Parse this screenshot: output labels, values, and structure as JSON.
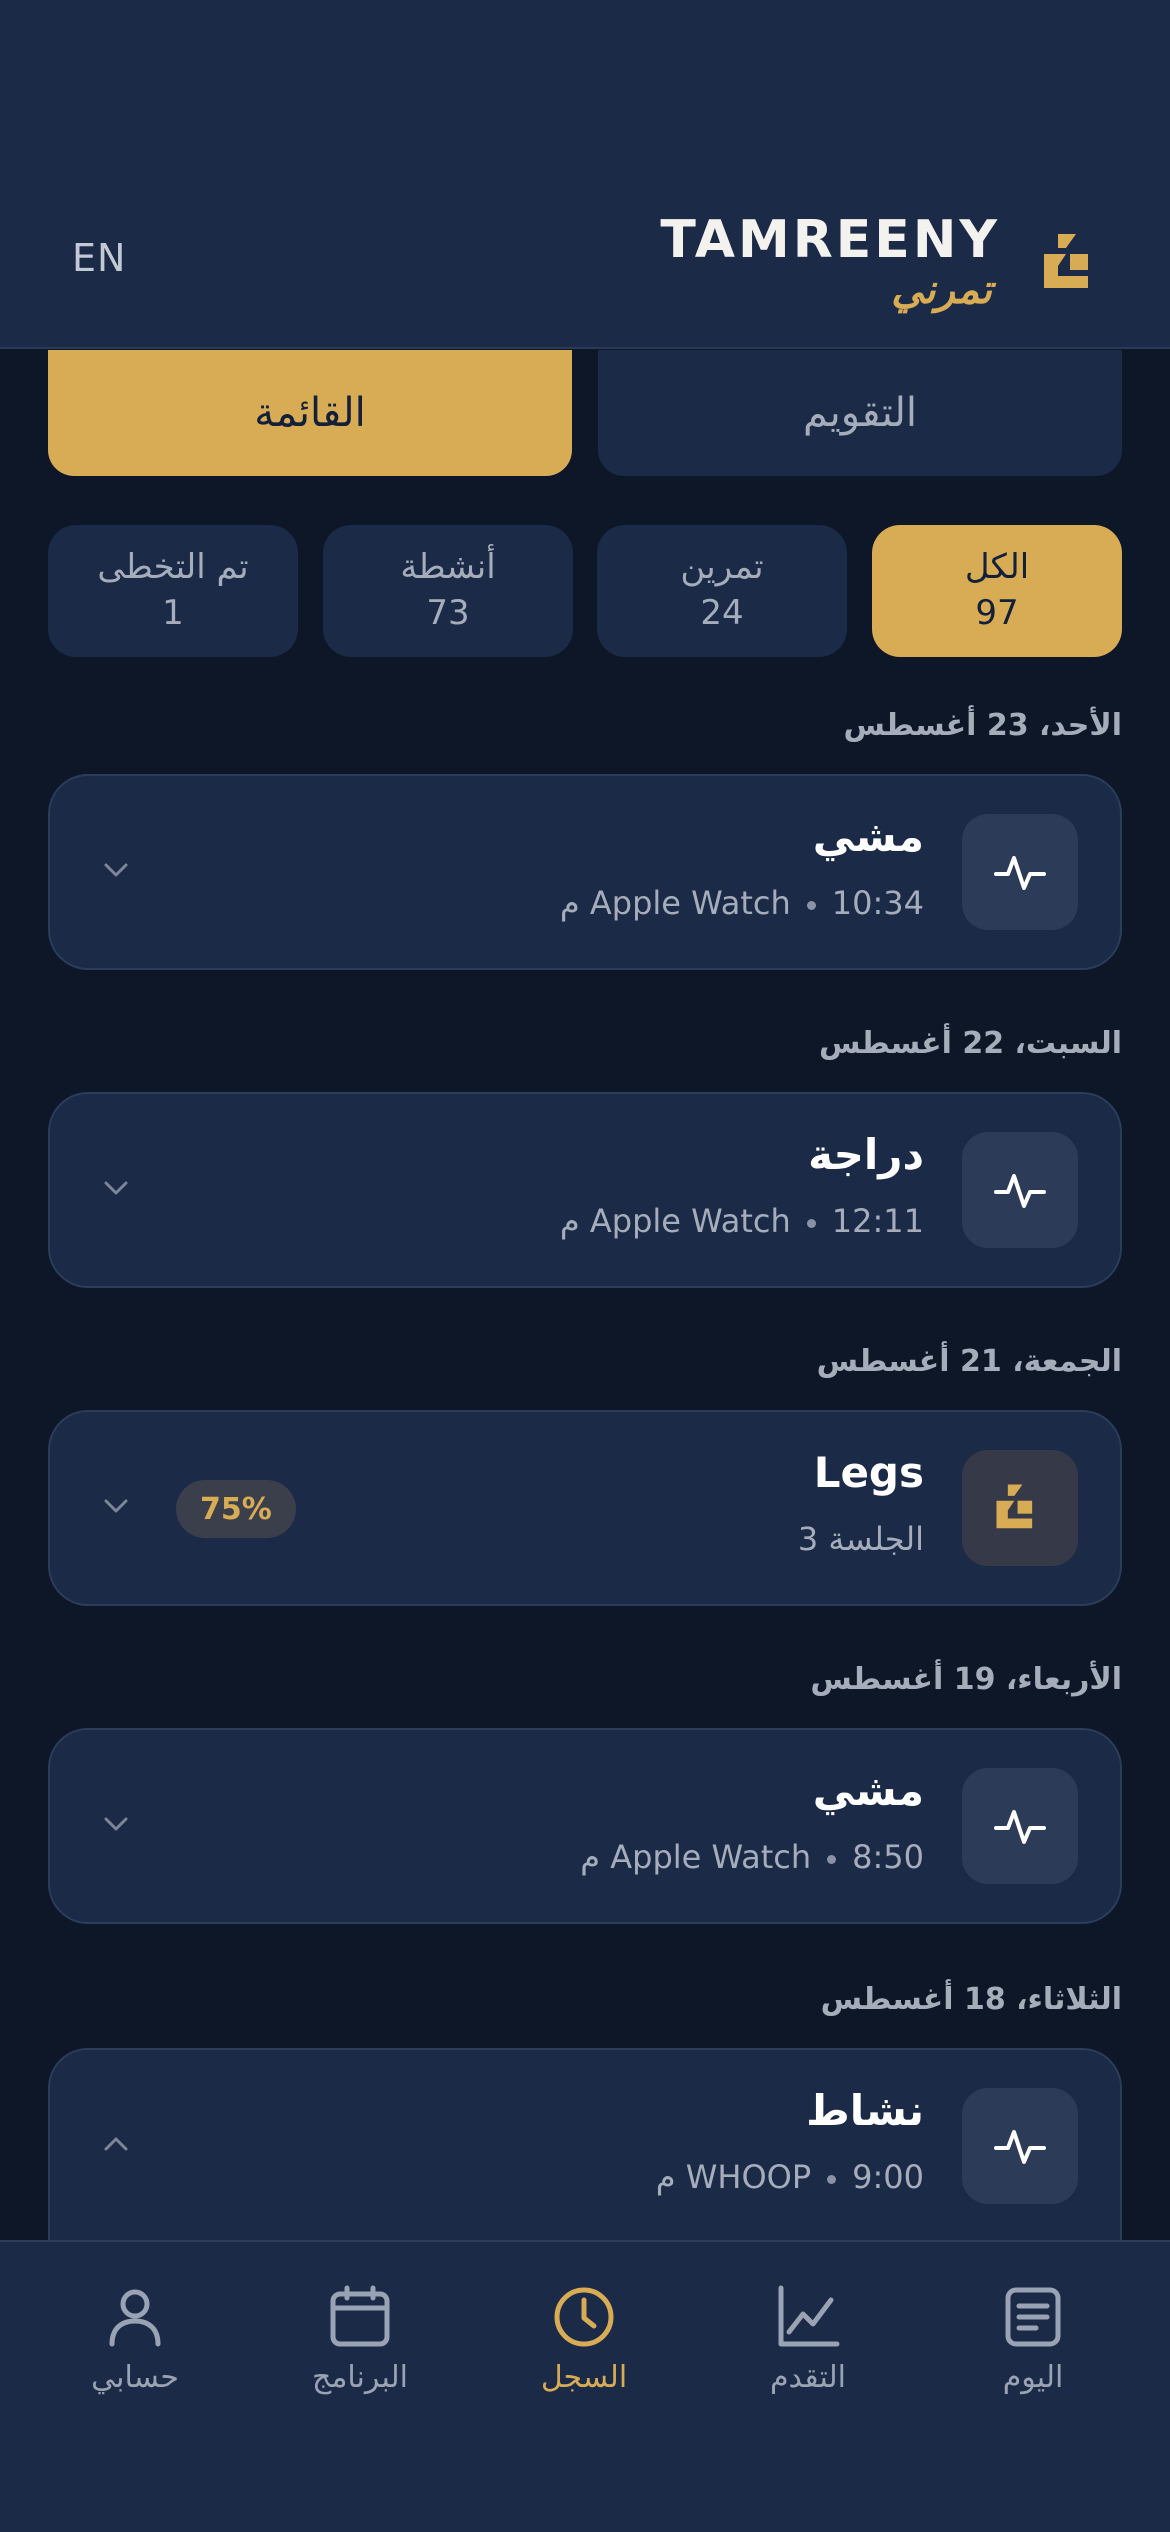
{
  "header": {
    "lang_toggle": "EN",
    "brand_title": "TAMREENY",
    "brand_subtitle": "تمرني",
    "accent_color": "#d8ab55",
    "background_color": "#1b2a47"
  },
  "view_toggle": {
    "list_label": "القائمة",
    "calendar_label": "التقويم",
    "selected": "list"
  },
  "filters": [
    {
      "label": "الكل",
      "count": "97",
      "active": true
    },
    {
      "label": "تمرين",
      "count": "24",
      "active": false
    },
    {
      "label": "أنشطة",
      "count": "73",
      "active": false
    },
    {
      "label": "تم التخطى",
      "count": "1",
      "active": false
    }
  ],
  "history": [
    {
      "date": "الأحد، 23 أغسطس",
      "title": "مشي",
      "source": "Apple Watch",
      "time": "10:34 م",
      "icon": "activity-pulse-icon"
    },
    {
      "date": "السبت، 22 أغسطس",
      "title": "دراجة",
      "source": "Apple Watch",
      "time": "12:11 م",
      "icon": "activity-pulse-icon"
    },
    {
      "date": "الجمعة، 21 أغسطس",
      "title": "Legs",
      "session": "الجلسة 3",
      "progress": "75%",
      "icon": "tamreeny-logo-icon"
    },
    {
      "date": "الأربعاء، 19 أغسطس",
      "title": "مشي",
      "source": "Apple Watch",
      "time": "8:50 م",
      "icon": "activity-pulse-icon"
    },
    {
      "date": "الثلاثاء، 18 أغسطس",
      "title": "نشاط",
      "source": "WHOOP",
      "time": "9:00 م",
      "icon": "activity-pulse-icon"
    }
  ],
  "tabbar": [
    {
      "label": "حسابي",
      "icon": "user-icon",
      "active": false
    },
    {
      "label": "البرنامج",
      "icon": "calendar-icon",
      "active": false
    },
    {
      "label": "السجل",
      "icon": "clock-icon",
      "active": true
    },
    {
      "label": "التقدم",
      "icon": "chart-line-icon",
      "active": false
    },
    {
      "label": "اليوم",
      "icon": "list-icon",
      "active": false
    }
  ]
}
